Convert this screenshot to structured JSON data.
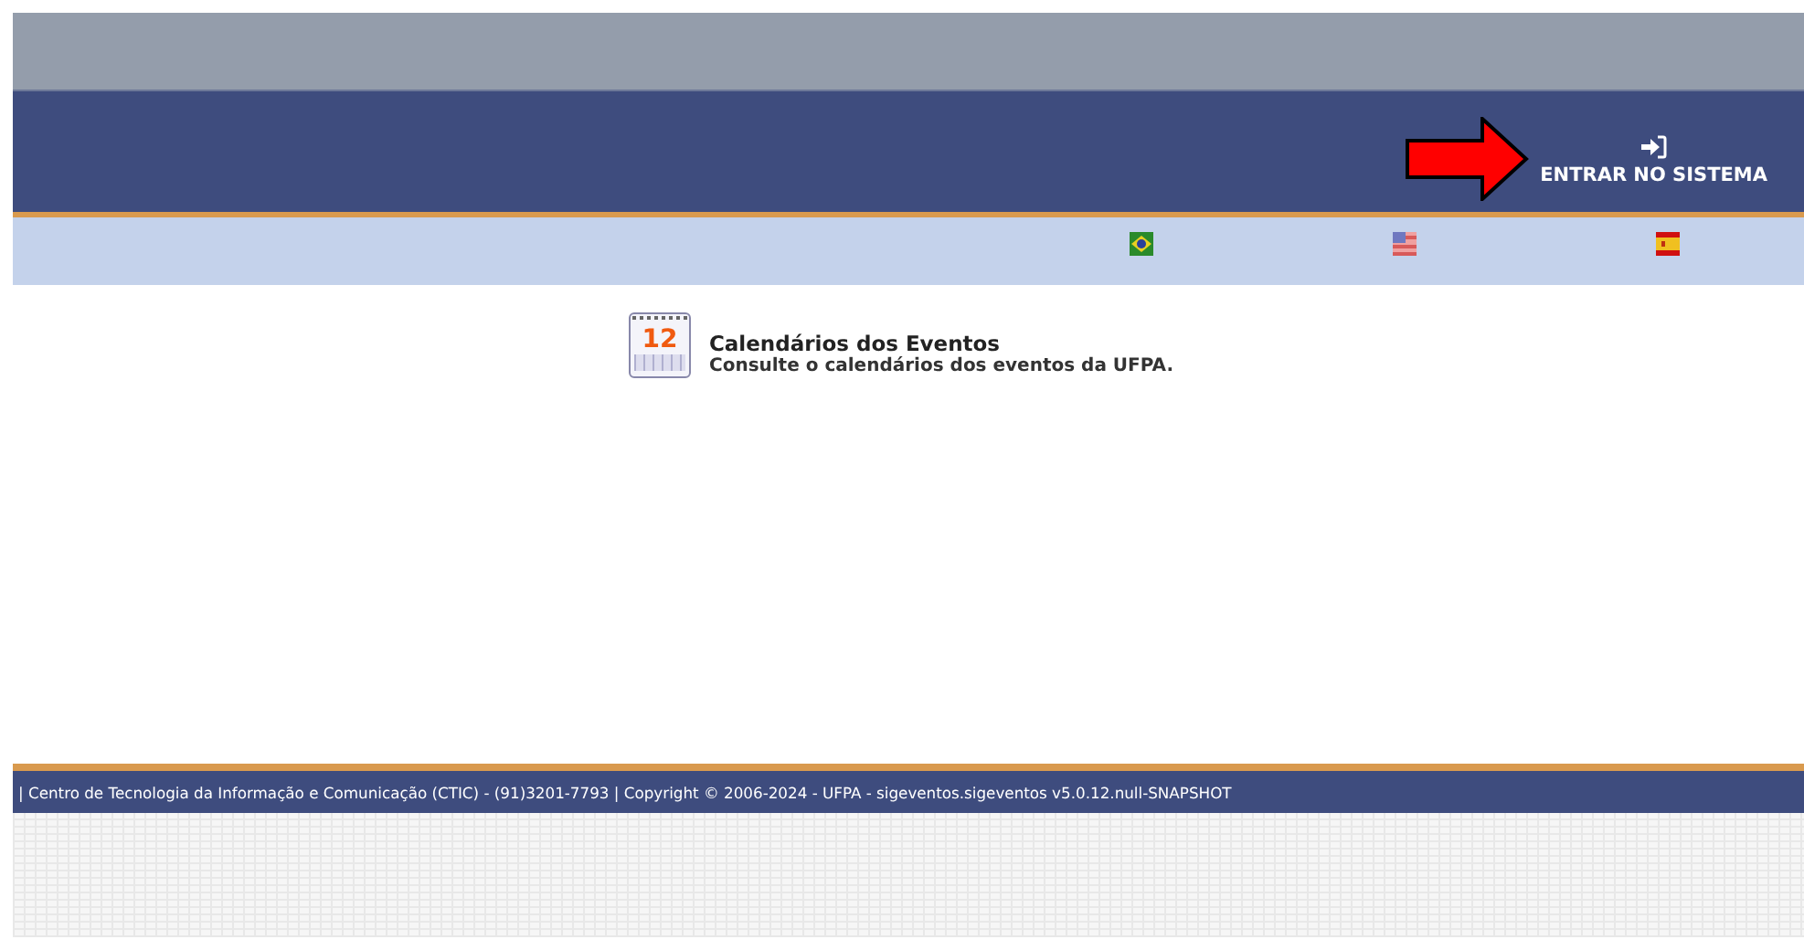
{
  "header": {
    "login": {
      "label": "ENTRAR NO SISTEMA"
    }
  },
  "languages": [
    {
      "kind": "br"
    },
    {
      "kind": "us"
    },
    {
      "kind": "es"
    }
  ],
  "items": [
    {
      "icon_text": "12",
      "title": "Calendários dos Eventos",
      "description": "Consulte o calendários dos eventos da UFPA."
    }
  ],
  "footer": {
    "text": "| Centro de Tecnologia da Informação e Comunicação (CTIC) - (91)3201-7793 | Copyright © 2006-2024 - UFPA - sigeventos.sigeventos v5.0.12.null-SNAPSHOT"
  }
}
